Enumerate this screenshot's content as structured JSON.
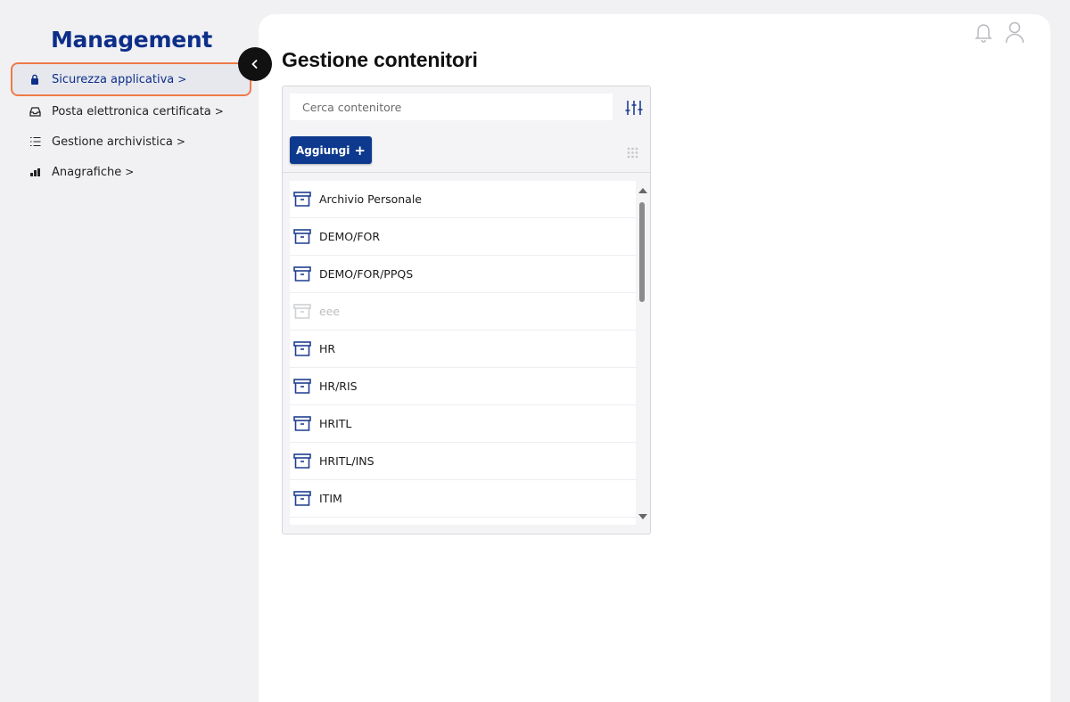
{
  "sidebar": {
    "brand": "Management",
    "items": [
      {
        "label": "Sicurezza applicativa",
        "icon": "lock-icon",
        "active": true
      },
      {
        "label": "Posta elettronica certificata",
        "icon": "inbox-icon",
        "active": false
      },
      {
        "label": "Gestione archivistica",
        "icon": "list-icon",
        "active": false
      },
      {
        "label": "Anagrafiche",
        "icon": "chart-icon",
        "active": false
      }
    ],
    "chevron": ">"
  },
  "header": {
    "title": "Gestione contenitori",
    "icons": [
      "bell-icon",
      "user-icon"
    ]
  },
  "panel": {
    "search_placeholder": "Cerca contenitore",
    "add_label": "Aggiungi",
    "add_icon": "+",
    "items": [
      {
        "label": "Archivio Personale",
        "disabled": false
      },
      {
        "label": "DEMO/FOR",
        "disabled": false
      },
      {
        "label": "DEMO/FOR/PPQS",
        "disabled": false
      },
      {
        "label": "eee",
        "disabled": true
      },
      {
        "label": "HR",
        "disabled": false
      },
      {
        "label": "HR/RIS",
        "disabled": false
      },
      {
        "label": "HRITL",
        "disabled": false
      },
      {
        "label": "HRITL/INS",
        "disabled": false
      },
      {
        "label": "ITIM",
        "disabled": false
      }
    ]
  },
  "colors": {
    "accent": "#0d2f8a",
    "button": "#0d3a8e",
    "highlight_border": "#ee7b47",
    "icon_blue": "#1f3f8f"
  }
}
